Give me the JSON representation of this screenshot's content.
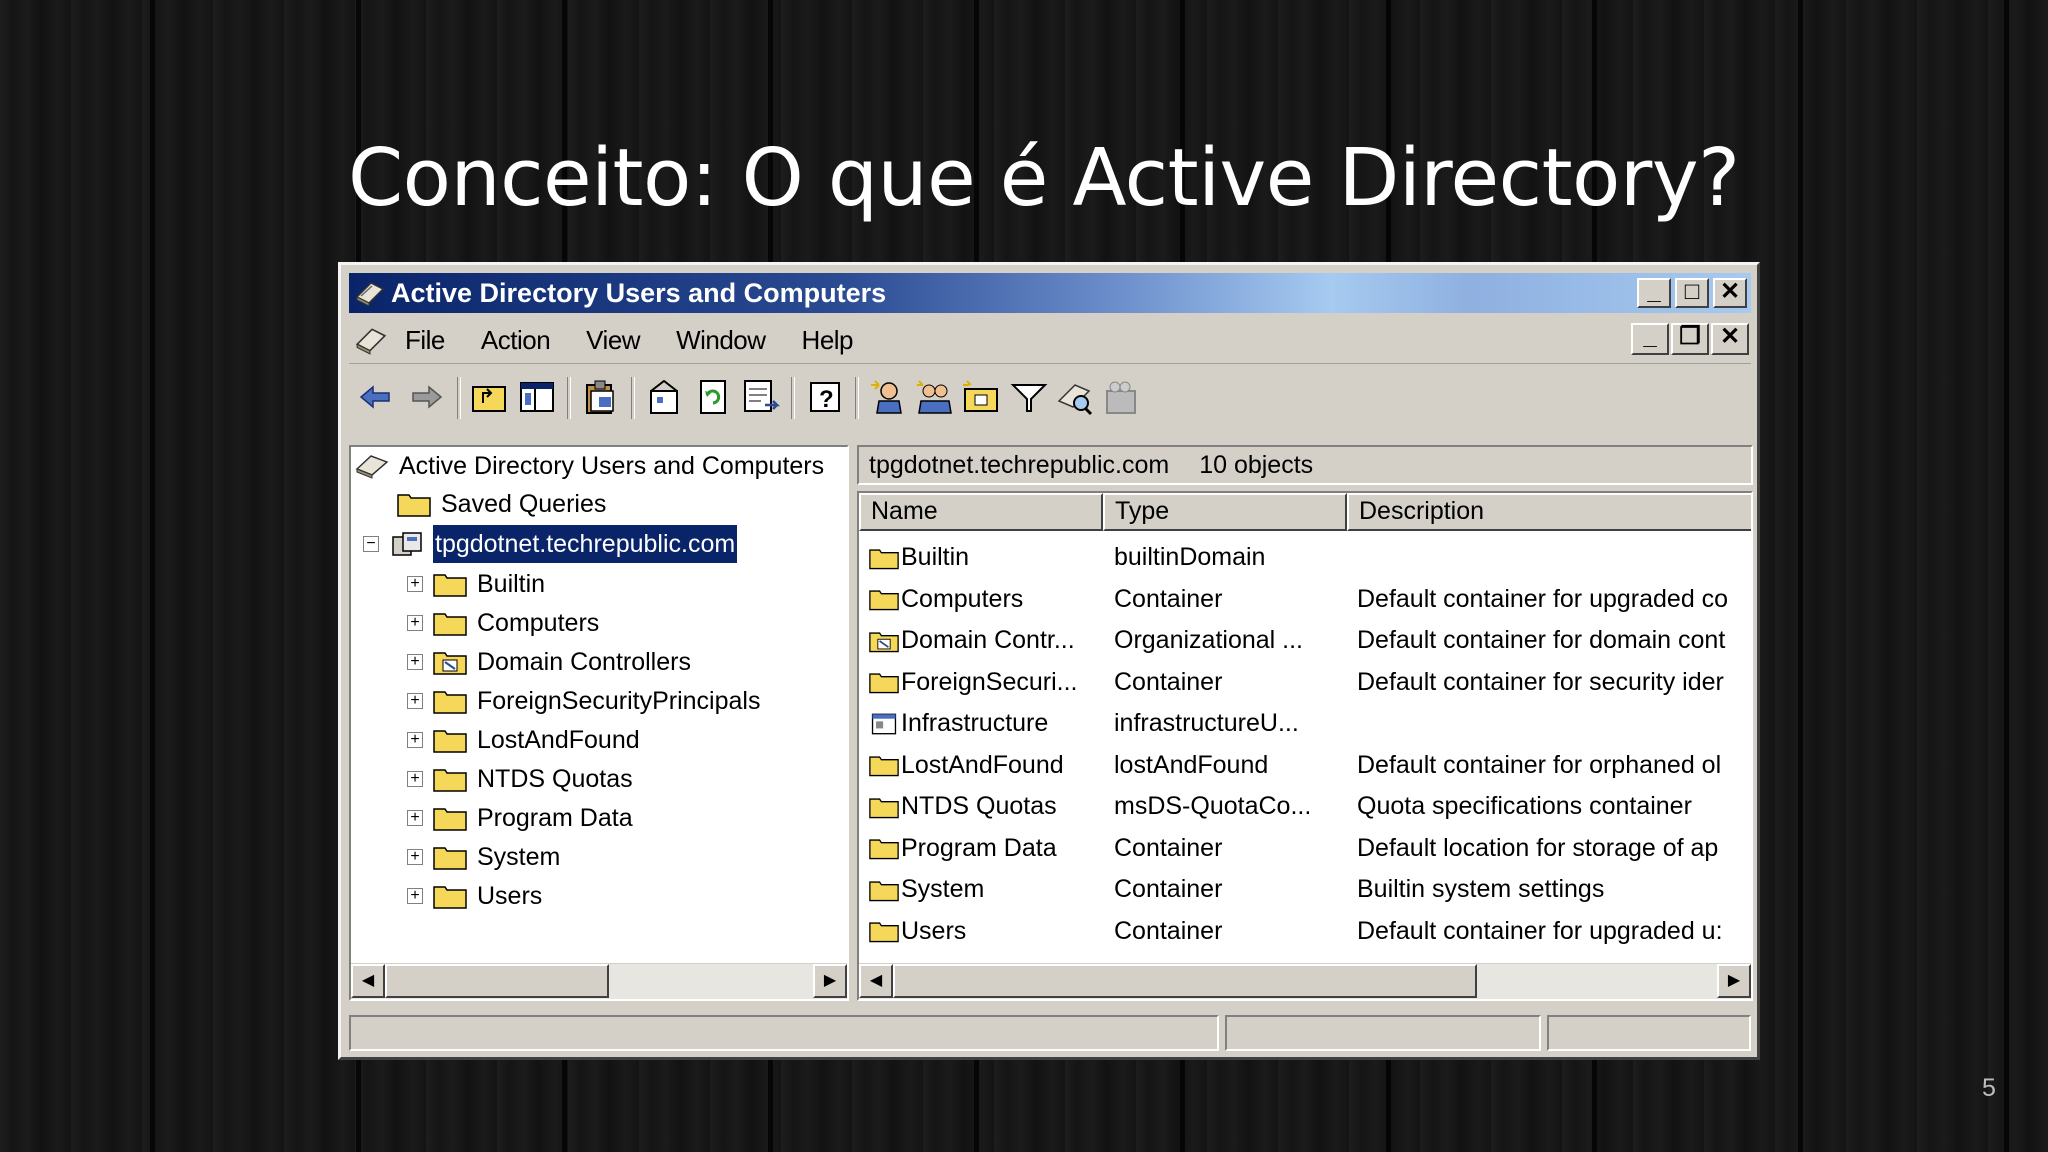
{
  "slide": {
    "title": "Conceito: O que é Active Directory?",
    "page_number": "5"
  },
  "window": {
    "title": "Active Directory Users and Computers",
    "title_buttons": [
      "_",
      "□",
      "✕"
    ],
    "menu": [
      "File",
      "Action",
      "View",
      "Window",
      "Help"
    ],
    "toolbar_icons": [
      "back-icon",
      "forward-icon",
      "up-folder-icon",
      "show-hide-tree-icon",
      "properties-clipboard-icon",
      "delegate-icon",
      "refresh-icon",
      "export-list-icon",
      "help-icon",
      "new-user-icon",
      "new-group-icon",
      "new-ou-icon",
      "filter-icon",
      "find-icon",
      "add-to-group-icon"
    ]
  },
  "tree": {
    "root": "Active Directory Users and Computers",
    "saved_queries": "Saved Queries",
    "domain": "tpgdotnet.techrepublic.com",
    "children": [
      "Builtin",
      "Computers",
      "Domain Controllers",
      "ForeignSecurityPrincipals",
      "LostAndFound",
      "NTDS Quotas",
      "Program Data",
      "System",
      "Users"
    ]
  },
  "details": {
    "location": "tpgdotnet.techrepublic.com",
    "count": "10 objects",
    "columns": [
      "Name",
      "Type",
      "Description"
    ],
    "rows": [
      {
        "name": "Builtin",
        "type": "builtinDomain",
        "desc": "",
        "icon": "folder"
      },
      {
        "name": "Computers",
        "type": "Container",
        "desc": "Default container for upgraded co",
        "icon": "folder"
      },
      {
        "name": "Domain Contr...",
        "type": "Organizational ...",
        "desc": "Default container for domain cont",
        "icon": "ou"
      },
      {
        "name": "ForeignSecuri...",
        "type": "Container",
        "desc": "Default container for security ider",
        "icon": "folder"
      },
      {
        "name": "Infrastructure",
        "type": "infrastructureU...",
        "desc": "",
        "icon": "object"
      },
      {
        "name": "LostAndFound",
        "type": "lostAndFound",
        "desc": "Default container for orphaned ol",
        "icon": "folder"
      },
      {
        "name": "NTDS Quotas",
        "type": "msDS-QuotaCo...",
        "desc": "Quota specifications container",
        "icon": "folder"
      },
      {
        "name": "Program Data",
        "type": "Container",
        "desc": "Default location for storage of ap",
        "icon": "folder"
      },
      {
        "name": "System",
        "type": "Container",
        "desc": "Builtin system settings",
        "icon": "folder"
      },
      {
        "name": "Users",
        "type": "Container",
        "desc": "Default container for upgraded u:",
        "icon": "folder"
      }
    ]
  },
  "colors": {
    "titlebar_start": "#0a246a",
    "titlebar_end": "#a6caf0",
    "face": "#d4d0c8",
    "selection": "#0a246a",
    "folder": "#f5d85a"
  }
}
